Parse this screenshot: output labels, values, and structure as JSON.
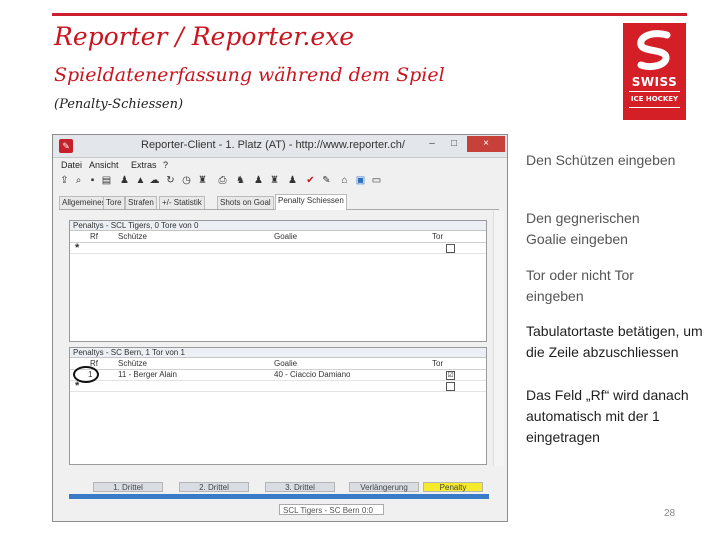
{
  "slide": {
    "title": "Reporter / Reporter.exe",
    "subtitle": "Spieldatenerfassung während dem Spiel",
    "subsubtitle": "(Penalty-Schiessen)",
    "page_number": "28",
    "accent_color": "#c8151f",
    "logo": {
      "line1": "SWISS",
      "line2": "ICE HOCKEY"
    },
    "notes": [
      "Den Schützen eingeben",
      "Den gegnerischen Goalie eingeben",
      "Tor oder nicht Tor eingeben",
      "Tabulatortaste betätigen, um die Zeile abzuschliessen",
      "Das Feld „Rf“ wird danach automatisch mit der 1 eingetragen"
    ]
  },
  "window": {
    "title": "Reporter-Client - 1. Platz (AT) - http://www.reporter.ch/",
    "min_label": "–",
    "max_label": "□",
    "close_label": "×",
    "menu": [
      "Datei",
      "Ansicht",
      "Extras",
      "?"
    ],
    "toolbar_icons": [
      "upload-icon",
      "search-icon",
      "save-icon",
      "clipboard-icon",
      "people-icon",
      "upload-green-icon",
      "cloud-icon",
      "refresh-icon",
      "clock-icon",
      "team-icon",
      "print-icon",
      "people-icon",
      "check-icon",
      "home-icon",
      "window-icon",
      "tv-icon"
    ],
    "tabs": [
      "Allgemeines",
      "Tore",
      "Strafen",
      "+/- Statistik",
      "Shots on Goal",
      "Penalty Schiessen"
    ],
    "active_tab": "Penalty Schiessen",
    "grid1": {
      "title": "Penaltys - SCL Tigers, 0 Tore von 0",
      "headers": {
        "rf": "Rf",
        "schuetze": "Schütze",
        "goalie": "Goalie",
        "tor": "Tor"
      },
      "new_row_marker": "*"
    },
    "grid2": {
      "title": "Penaltys - SC Bern, 1 Tor von 1",
      "headers": {
        "rf": "Rf",
        "schuetze": "Schütze",
        "goalie": "Goalie",
        "tor": "Tor"
      },
      "rows": [
        {
          "rf": "1",
          "schuetze": "11 - Berger Alain",
          "goalie": "40 - Ciaccio Damiano",
          "tor": "☑"
        }
      ],
      "new_row_marker": "*"
    },
    "periods": [
      "1. Drittel",
      "2. Drittel",
      "3. Drittel",
      "Verlängerung",
      "Penalty"
    ],
    "active_period": "Penalty",
    "status": "SCL Tigers - SC Bern 0:0"
  }
}
